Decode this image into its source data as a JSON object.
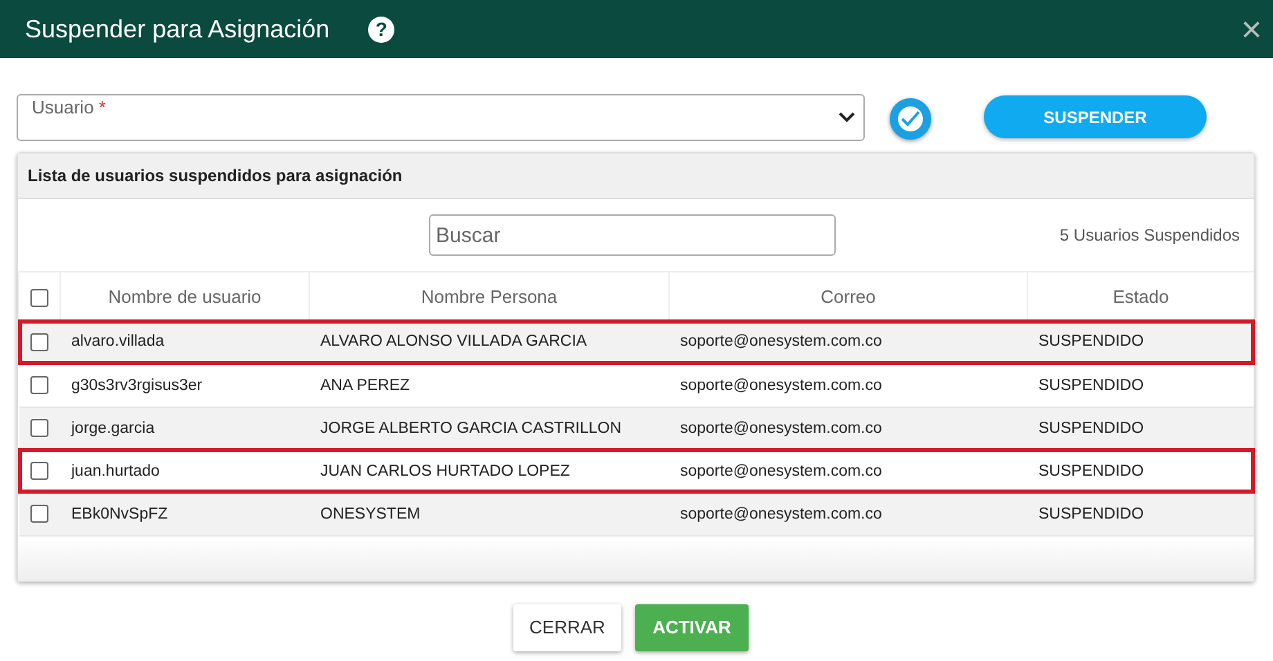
{
  "window": {
    "title": "Suspender para Asignación",
    "help": "?",
    "close": "×"
  },
  "user_field": {
    "label": "Usuario",
    "required": "*"
  },
  "confirm_checkbox": {
    "checked": true
  },
  "suspend_button": "SUSPENDER",
  "list": {
    "title": "Lista de usuarios suspendidos para asignación",
    "search": {
      "placeholder": "Buscar"
    },
    "count": "5 Usuarios Suspendidos",
    "select_all": {
      "checked": false
    },
    "columns": [
      "Nombre de usuario",
      "Nombre Persona",
      "Correo",
      "Estado"
    ],
    "rows": [
      {
        "cells": [
          "alvaro.villada",
          "ALVARO ALONSO VILLADA GARCIA",
          "soporte@onesystem.com.co",
          "SUSPENDIDO"
        ],
        "checked": false,
        "highlighted": true
      },
      {
        "cells": [
          "g30s3rv3rgisus3er",
          "ANA PEREZ",
          "soporte@onesystem.com.co",
          "SUSPENDIDO"
        ],
        "checked": false,
        "highlighted": false
      },
      {
        "cells": [
          "jorge.garcia",
          "JORGE ALBERTO GARCIA CASTRILLON",
          "soporte@onesystem.com.co",
          "SUSPENDIDO"
        ],
        "checked": false,
        "highlighted": false
      },
      {
        "cells": [
          "juan.hurtado",
          "JUAN CARLOS HURTADO LOPEZ",
          "soporte@onesystem.com.co",
          "SUSPENDIDO"
        ],
        "checked": false,
        "highlighted": true
      },
      {
        "cells": [
          "EBk0NvSpFZ",
          "ONESYSTEM",
          "soporte@onesystem.com.co",
          "SUSPENDIDO"
        ],
        "checked": false,
        "highlighted": false
      }
    ]
  },
  "buttons": [
    {
      "label": "CERRAR",
      "kind": "secondary"
    },
    {
      "label": "ACTIVAR",
      "kind": "primary"
    }
  ]
}
